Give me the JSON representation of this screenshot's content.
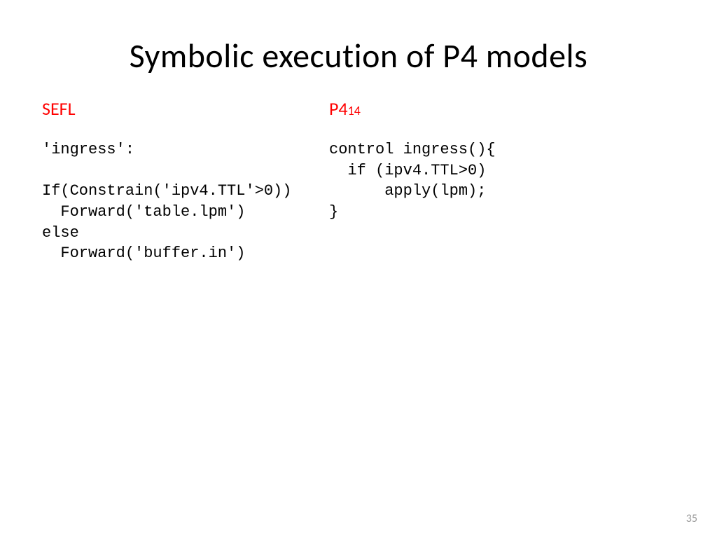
{
  "title": "Symbolic execution of P4 models",
  "left": {
    "heading": "SEFL",
    "code": "'ingress':\n\nIf(Constrain('ipv4.TTL'>0))\n  Forward('table.lpm')\nelse\n  Forward('buffer.in')"
  },
  "right": {
    "heading_main": "P4",
    "heading_sub": "14",
    "code": "control ingress(){\n  if (ipv4.TTL>0)\n      apply(lpm);\n}"
  },
  "page_number": "35"
}
